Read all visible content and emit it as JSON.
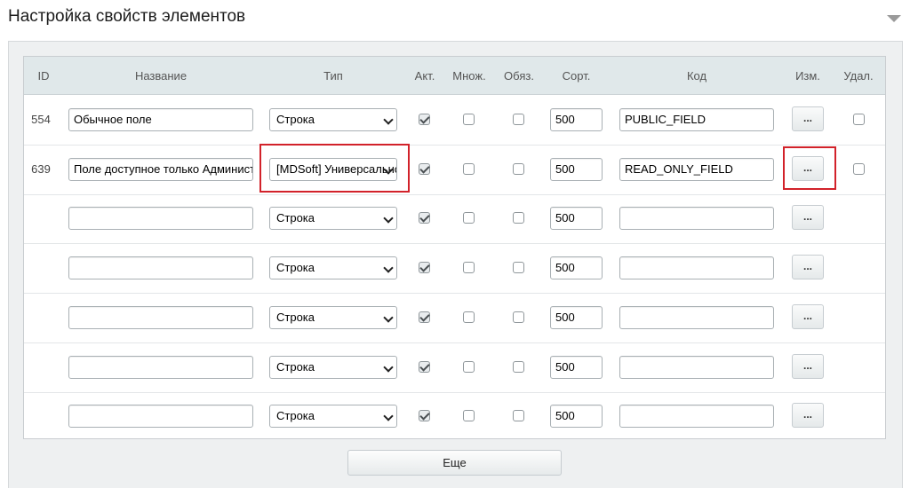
{
  "header": {
    "title": "Настройка свойств элементов"
  },
  "table": {
    "columns": {
      "id": "ID",
      "name": "Название",
      "type": "Тип",
      "active": "Акт.",
      "multiple": "Множ.",
      "required": "Обяз.",
      "sort": "Сорт.",
      "code": "Код",
      "edit": "Изм.",
      "delete": "Удал."
    },
    "rows": [
      {
        "id": "554",
        "name": "Обычное поле",
        "type": "Строка",
        "active": true,
        "multiple": false,
        "required": false,
        "sort": "500",
        "code": "PUBLIC_FIELD",
        "edit": "...",
        "has_delete": true,
        "highlighted": false
      },
      {
        "id": "639",
        "name": "Поле доступное только Администратору",
        "type": "[MDSoft] Универсальное",
        "active": true,
        "multiple": false,
        "required": false,
        "sort": "500",
        "code": "READ_ONLY_FIELD",
        "edit": "...",
        "has_delete": true,
        "highlighted": true
      },
      {
        "id": "",
        "name": "",
        "type": "Строка",
        "active": true,
        "multiple": false,
        "required": false,
        "sort": "500",
        "code": "",
        "edit": "...",
        "has_delete": false,
        "highlighted": false
      },
      {
        "id": "",
        "name": "",
        "type": "Строка",
        "active": true,
        "multiple": false,
        "required": false,
        "sort": "500",
        "code": "",
        "edit": "...",
        "has_delete": false,
        "highlighted": false
      },
      {
        "id": "",
        "name": "",
        "type": "Строка",
        "active": true,
        "multiple": false,
        "required": false,
        "sort": "500",
        "code": "",
        "edit": "...",
        "has_delete": false,
        "highlighted": false
      },
      {
        "id": "",
        "name": "",
        "type": "Строка",
        "active": true,
        "multiple": false,
        "required": false,
        "sort": "500",
        "code": "",
        "edit": "...",
        "has_delete": false,
        "highlighted": false
      },
      {
        "id": "",
        "name": "",
        "type": "Строка",
        "active": true,
        "multiple": false,
        "required": false,
        "sort": "500",
        "code": "",
        "edit": "...",
        "has_delete": false,
        "highlighted": false
      }
    ]
  },
  "footer": {
    "more_label": "Еще"
  },
  "colors": {
    "highlight": "#d2222a",
    "header_bg": "#e0e8ea",
    "panel_bg": "#eef0f1"
  }
}
